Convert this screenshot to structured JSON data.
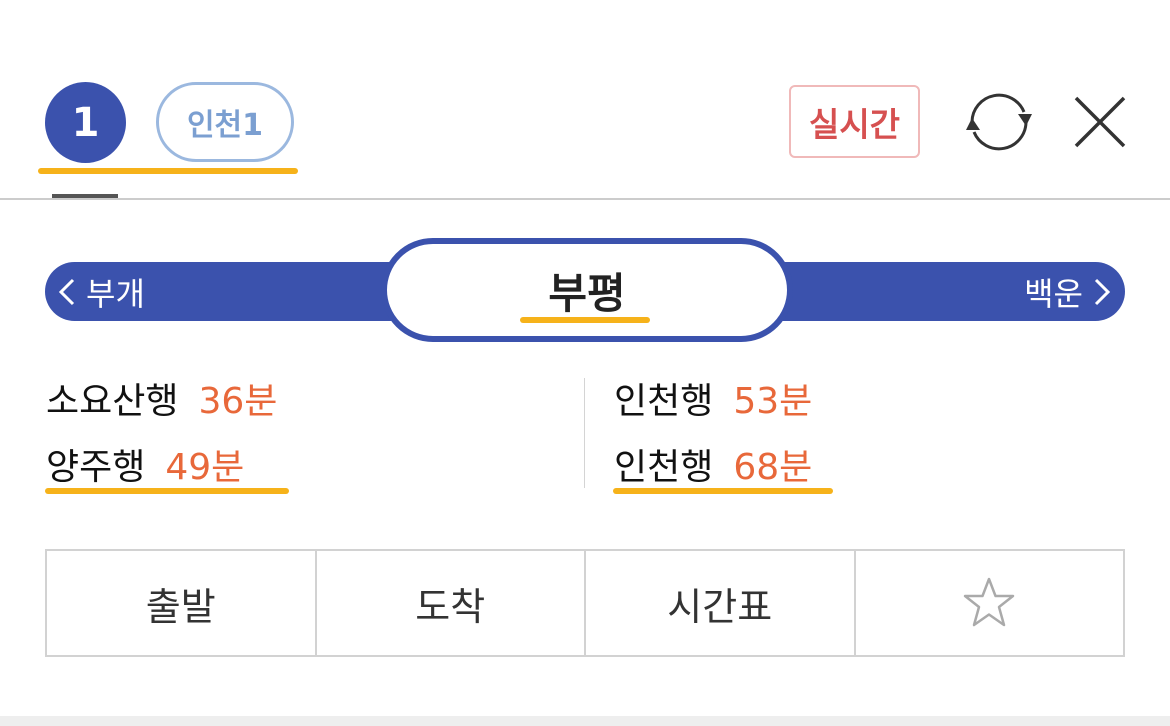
{
  "header": {
    "line_number": "1",
    "line_name": "인천1",
    "realtime_label": "실시간",
    "refresh_icon": "refresh-icon",
    "close_icon": "close-icon"
  },
  "station": {
    "prev": "부개",
    "current": "부평",
    "next": "백운"
  },
  "arrivals": {
    "left": [
      {
        "destination": "소요산행",
        "time": "36분"
      },
      {
        "destination": "양주행",
        "time": "49분"
      }
    ],
    "right": [
      {
        "destination": "인천행",
        "time": "53분"
      },
      {
        "destination": "인천행",
        "time": "68분"
      }
    ]
  },
  "actions": {
    "departure": "출발",
    "arrival": "도착",
    "timetable": "시간표",
    "favorite_icon": "star-icon"
  },
  "colors": {
    "line_blue": "#3b52ad",
    "time_orange": "#e8683a",
    "highlight": "#f6b21a",
    "realtime_red": "#d65050"
  }
}
